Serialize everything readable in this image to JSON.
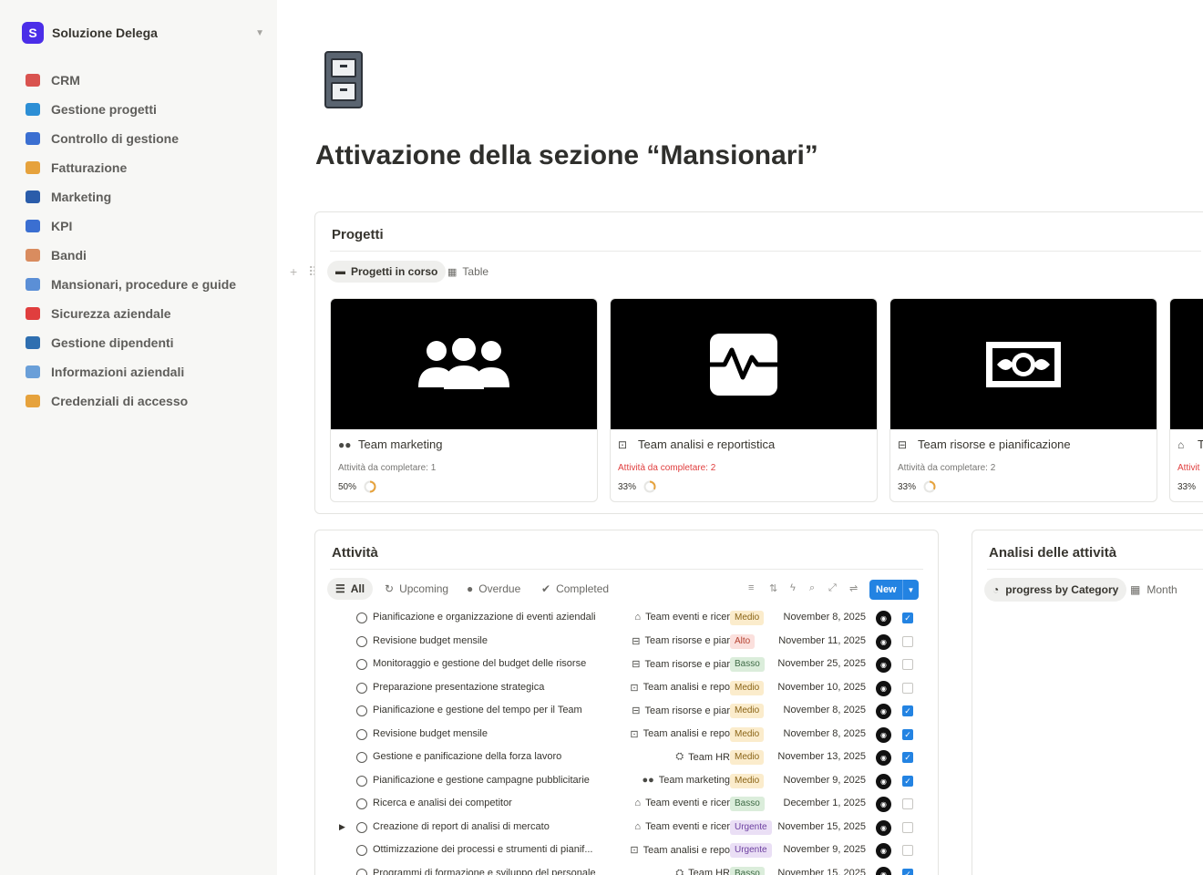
{
  "workspace": {
    "name": "Soluzione Delega",
    "logo_letter": "S"
  },
  "sidebar": {
    "items": [
      {
        "label": "CRM",
        "icon": "card-box-icon",
        "color": "#d9534f"
      },
      {
        "label": "Gestione progetti",
        "icon": "folder-icon",
        "color": "#2d8fd5"
      },
      {
        "label": "Controllo di gestione",
        "icon": "bar-chart-icon",
        "color": "#3b6fd1"
      },
      {
        "label": "Fatturazione",
        "icon": "money-bag-icon",
        "color": "#e6a23c"
      },
      {
        "label": "Marketing",
        "icon": "megaphone-icon",
        "color": "#2a5caa"
      },
      {
        "label": "KPI",
        "icon": "chart-icon",
        "color": "#3b6fd1"
      },
      {
        "label": "Bandi",
        "icon": "clipboard-icon",
        "color": "#d98c5f"
      },
      {
        "label": "Mansionari, procedure e guide",
        "icon": "books-icon",
        "color": "#5b8fd6"
      },
      {
        "label": "Sicurezza aziendale",
        "icon": "no-entry-icon",
        "color": "#e03e3e"
      },
      {
        "label": "Gestione dipendenti",
        "icon": "people-icon",
        "color": "#2f6fb0"
      },
      {
        "label": "Informazioni aziendali",
        "icon": "memo-icon",
        "color": "#6a9fd8"
      },
      {
        "label": "Credenziali di accesso",
        "icon": "lock-icon",
        "color": "#e6a23c"
      }
    ]
  },
  "page": {
    "title": "Attivazione della sezione “Mansionari”",
    "icon": "file-cabinet-icon"
  },
  "progetti": {
    "title": "Progetti",
    "views": [
      {
        "label": "Progetti in corso",
        "icon": "cabinet-icon"
      },
      {
        "label": "Table",
        "icon": "table-icon"
      }
    ],
    "cards": [
      {
        "title": "Team marketing",
        "icon": "people-icon",
        "subtitle": "Attività da completare: 1",
        "sub_red": false,
        "progress_label": "50%",
        "progress": 0.5
      },
      {
        "title": "Team analisi e reportistica",
        "icon": "pulse-icon",
        "subtitle": "Attività da completare: 2",
        "sub_red": true,
        "progress_label": "33%",
        "progress": 0.33
      },
      {
        "title": "Team risorse e pianificazione",
        "icon": "money-icon",
        "subtitle": "Attività da completare: 2",
        "sub_red": false,
        "progress_label": "33%",
        "progress": 0.33
      },
      {
        "title": "Te",
        "icon": "bank-icon",
        "subtitle": "Attivit",
        "sub_red": true,
        "progress_label": "33%",
        "progress": 0.33
      }
    ]
  },
  "attivita": {
    "title": "Attività",
    "tabs": [
      {
        "label": "All",
        "icon": "list-icon"
      },
      {
        "label": "Upcoming",
        "icon": "refresh-icon"
      },
      {
        "label": "Overdue",
        "icon": "alert-icon"
      },
      {
        "label": "Completed",
        "icon": "check-circle-icon"
      }
    ],
    "new_label": "New",
    "tasks": [
      {
        "name": "Pianificazione e organizzazione di eventi aziendali",
        "team": "Team eventi e ricer",
        "team_icon": "bank-icon",
        "priority": "Medio",
        "date": "November 8, 2025",
        "done": true,
        "expand": false
      },
      {
        "name": "Revisione budget mensile",
        "team": "Team risorse e piar",
        "team_icon": "money-icon",
        "priority": "Alto",
        "date": "November 11, 2025",
        "done": false,
        "expand": false
      },
      {
        "name": "Monitoraggio e gestione del budget delle risorse",
        "team": "Team risorse e piar",
        "team_icon": "money-icon",
        "priority": "Basso",
        "date": "November 25, 2025",
        "done": false,
        "expand": false
      },
      {
        "name": "Preparazione presentazione strategica",
        "team": "Team analisi e repo",
        "team_icon": "pulse-icon",
        "priority": "Medio",
        "date": "November 10, 2025",
        "done": false,
        "expand": false
      },
      {
        "name": "Pianificazione e gestione del tempo per il Team",
        "team": "Team risorse e piar",
        "team_icon": "money-icon",
        "priority": "Medio",
        "date": "November 8, 2025",
        "done": true,
        "expand": false
      },
      {
        "name": "Revisione budget mensile",
        "team": "Team analisi e repo",
        "team_icon": "pulse-icon",
        "priority": "Medio",
        "date": "November 8, 2025",
        "done": true,
        "expand": false
      },
      {
        "name": "Gestione e panificazione della forza lavoro",
        "team": "Team HR",
        "team_icon": "graduation-cap-icon",
        "priority": "Medio",
        "date": "November 13, 2025",
        "done": true,
        "expand": false
      },
      {
        "name": "Pianificazione e gestione campagne pubblicitarie",
        "team": "Team marketing",
        "team_icon": "people-icon",
        "priority": "Medio",
        "date": "November 9, 2025",
        "done": true,
        "expand": false
      },
      {
        "name": "Ricerca e analisi dei competitor",
        "team": "Team eventi e ricer",
        "team_icon": "bank-icon",
        "priority": "Basso",
        "date": "December 1, 2025",
        "done": false,
        "expand": false
      },
      {
        "name": "Creazione di report di analisi di mercato",
        "team": "Team eventi e ricer",
        "team_icon": "bank-icon",
        "priority": "Urgente",
        "date": "November 15, 2025",
        "done": false,
        "expand": true
      },
      {
        "name": "Ottimizzazione dei processi e strumenti di pianif...",
        "team": "Team analisi e repo",
        "team_icon": "pulse-icon",
        "priority": "Urgente",
        "date": "November 9, 2025",
        "done": false,
        "expand": false
      },
      {
        "name": "Programmi di formazione e sviluppo del personale",
        "team": "Team HR",
        "team_icon": "graduation-cap-icon",
        "priority": "Basso",
        "date": "November 15, 2025",
        "done": true,
        "expand": false
      }
    ]
  },
  "analisi": {
    "title": "Analisi delle attività",
    "tabs": [
      {
        "label": "progress by Category",
        "icon": "pie-icon"
      },
      {
        "label": "Month",
        "icon": "calendar-icon"
      }
    ]
  },
  "priority_colors": {
    "Medio": {
      "bg": "#fbeccc",
      "fg": "#8a6416"
    },
    "Alto": {
      "bg": "#fbe0dd",
      "fg": "#b4402f"
    },
    "Basso": {
      "bg": "#dbeddb",
      "fg": "#3f6b47"
    },
    "Urgente": {
      "bg": "#eadff5",
      "fg": "#6c3fa0"
    }
  }
}
